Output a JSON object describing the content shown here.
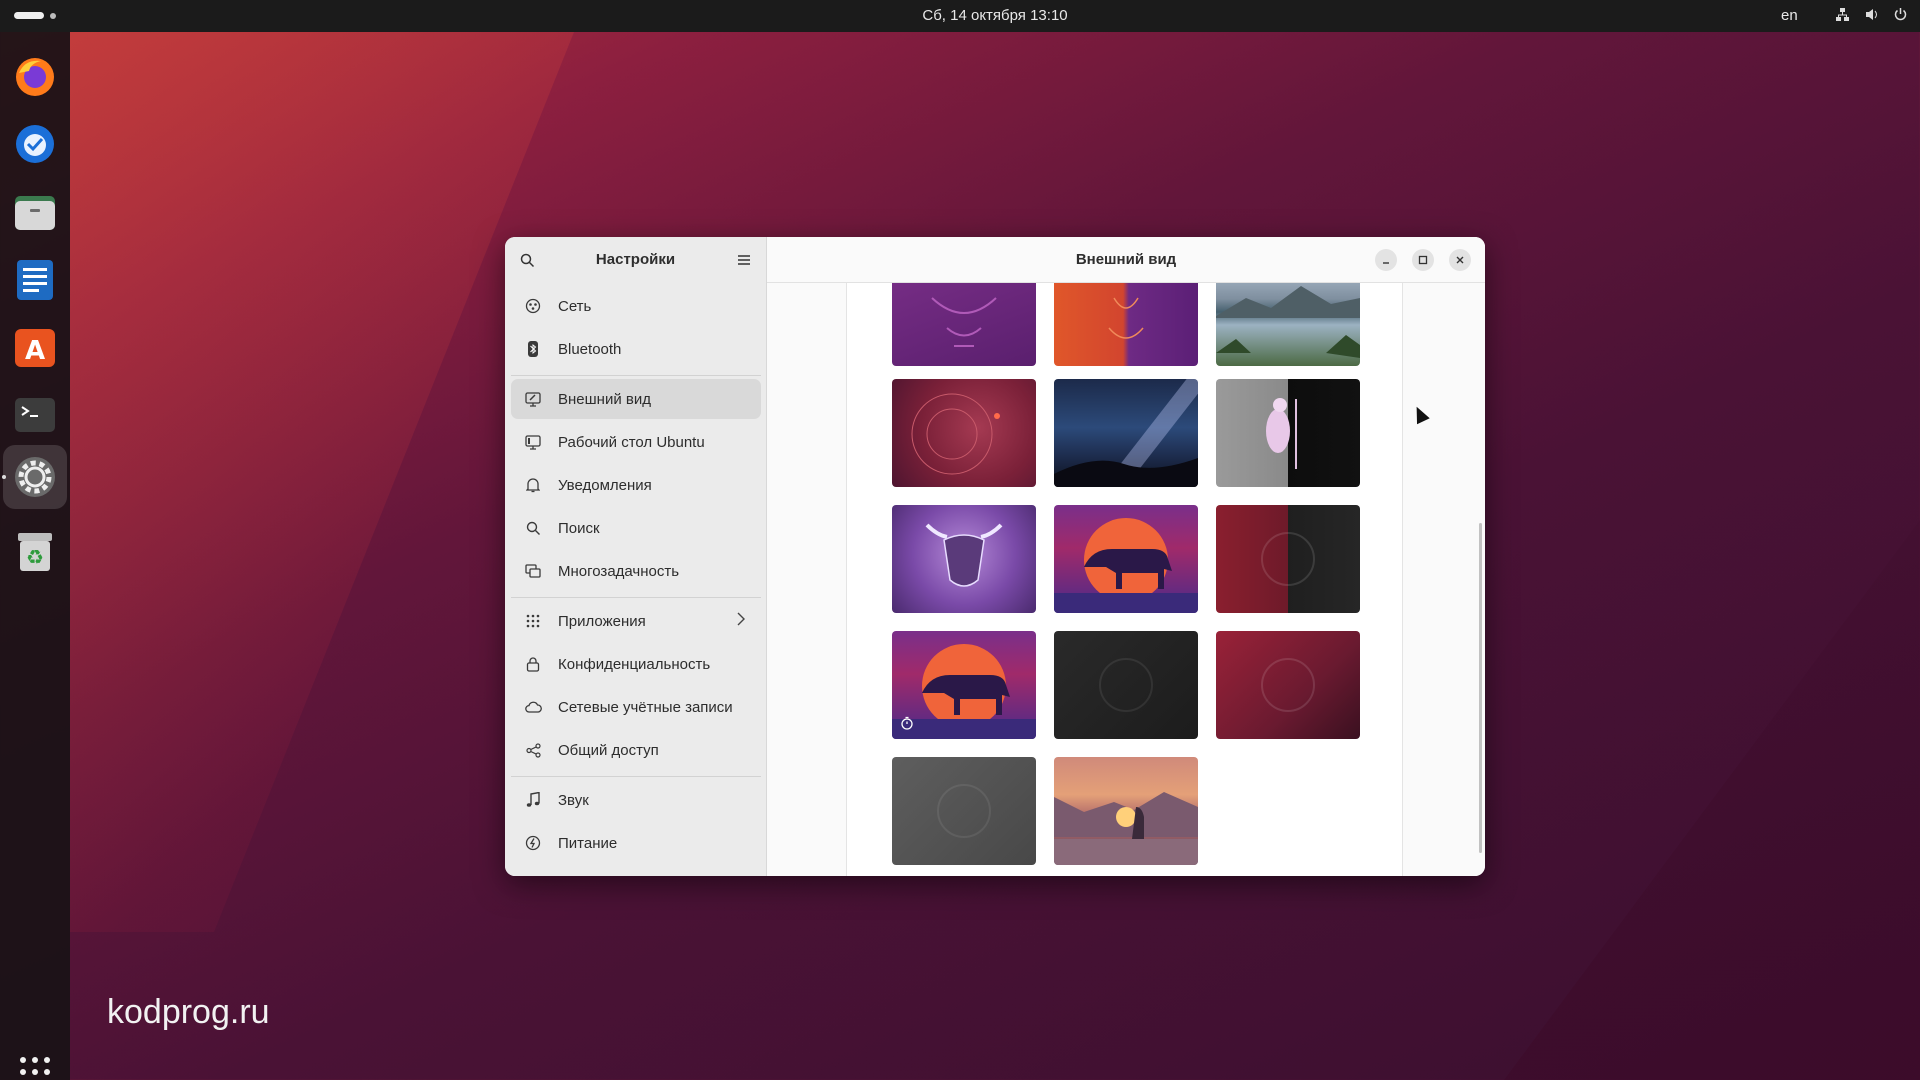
{
  "topbar": {
    "datetime": "Сб, 14 октября  13:10",
    "lang": "en"
  },
  "dock": {
    "apps": [
      {
        "name": "firefox",
        "icon": "firefox-icon"
      },
      {
        "name": "thunderbird",
        "icon": "thunderbird-icon"
      },
      {
        "name": "files",
        "icon": "files-icon"
      },
      {
        "name": "writer",
        "icon": "writer-icon"
      },
      {
        "name": "app-center",
        "icon": "app-center-icon"
      },
      {
        "name": "terminal",
        "icon": "terminal-icon"
      },
      {
        "name": "settings",
        "icon": "settings-icon",
        "active": true
      },
      {
        "name": "trash",
        "icon": "trash-icon"
      }
    ]
  },
  "watermark": "kodprog.ru",
  "settings": {
    "sidebar_title": "Настройки",
    "page_title": "Внешний вид",
    "items": [
      {
        "label": "Сеть",
        "icon": "network-icon"
      },
      {
        "label": "Bluetooth",
        "icon": "bluetooth-icon"
      },
      {
        "label": "Внешний вид",
        "icon": "appearance-icon",
        "selected": true
      },
      {
        "label": "Рабочий стол Ubuntu",
        "icon": "desktop-icon"
      },
      {
        "label": "Уведомления",
        "icon": "bell-icon"
      },
      {
        "label": "Поиск",
        "icon": "search-icon"
      },
      {
        "label": "Многозадачность",
        "icon": "multitasking-icon"
      },
      {
        "label": "Приложения",
        "icon": "apps-grid-icon"
      },
      {
        "label": "Конфиденциальность",
        "icon": "lock-icon"
      },
      {
        "label": "Сетевые учётные записи",
        "icon": "cloud-icon"
      },
      {
        "label": "Общий доступ",
        "icon": "share-icon"
      },
      {
        "label": "Звук",
        "icon": "music-note-icon"
      },
      {
        "label": "Питание",
        "icon": "power-icon"
      }
    ]
  },
  "wallpapers": [
    {
      "name": "purple-bull-outline"
    },
    {
      "name": "orange-purple-bull"
    },
    {
      "name": "mountain-lake"
    },
    {
      "name": "red-orbits"
    },
    {
      "name": "milky-way"
    },
    {
      "name": "light-dark-warrior"
    },
    {
      "name": "purple-beast"
    },
    {
      "name": "sunset-bull"
    },
    {
      "name": "red-dark-split"
    },
    {
      "name": "sunset-bull-timed",
      "timed": true
    },
    {
      "name": "dark-logo"
    },
    {
      "name": "red-logo"
    },
    {
      "name": "grey-logo"
    },
    {
      "name": "warrior-lake"
    }
  ],
  "colors": {
    "topbar": "#1b1b1b",
    "sidebar": "#ebebeb",
    "selected": "#d9d9d9"
  }
}
